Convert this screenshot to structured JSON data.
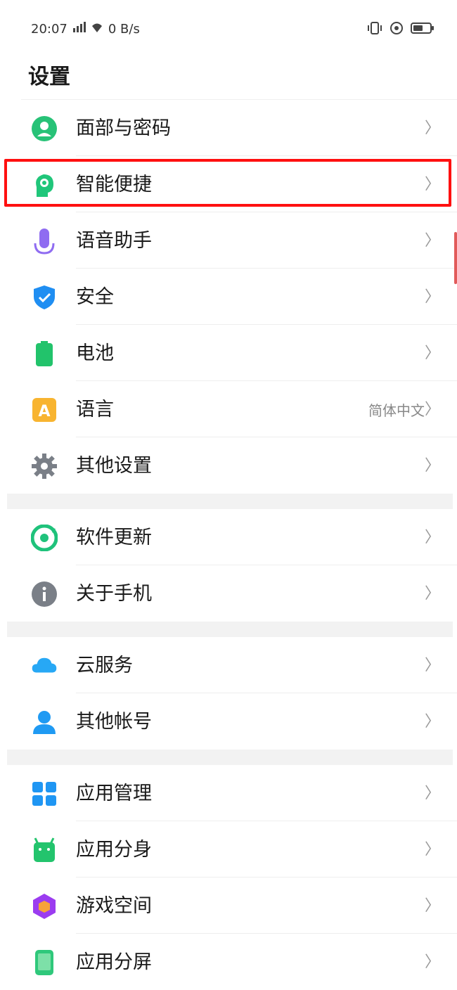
{
  "status_bar": {
    "time": "20:07",
    "speed": "0 B/s"
  },
  "title": "设置",
  "groups": [
    {
      "items": [
        {
          "label": "面部与密码",
          "icon": "face-password-icon",
          "color": "#27c277"
        },
        {
          "label": "智能便捷",
          "icon": "smart-assist-icon",
          "color": "#20c67a"
        },
        {
          "label": "语音助手",
          "icon": "microphone-icon",
          "color": "#8f6cf1"
        },
        {
          "label": "安全",
          "icon": "shield-icon",
          "color": "#1f8ef2"
        },
        {
          "label": "电池",
          "icon": "battery-icon",
          "color": "#22c36b"
        },
        {
          "label": "语言",
          "icon": "language-icon",
          "color": "#f8b430",
          "value": "简体中文"
        },
        {
          "label": "其他设置",
          "icon": "gear-icon",
          "color": "#7a7f87"
        }
      ]
    },
    {
      "items": [
        {
          "label": "软件更新",
          "icon": "software-update-icon",
          "color": "#1fc27b"
        },
        {
          "label": "关于手机",
          "icon": "info-icon",
          "color": "#7a7f87"
        }
      ]
    },
    {
      "items": [
        {
          "label": "云服务",
          "icon": "cloud-icon",
          "color": "#27a8f5"
        },
        {
          "label": "其他帐号",
          "icon": "account-icon",
          "color": "#1f9af3"
        }
      ]
    },
    {
      "items": [
        {
          "label": "应用管理",
          "icon": "app-manage-icon",
          "color": "#1f96f3"
        },
        {
          "label": "应用分身",
          "icon": "app-clone-icon",
          "color": "#23c46d"
        },
        {
          "label": "游戏空间",
          "icon": "game-space-icon",
          "color": "#9b3cf0"
        },
        {
          "label": "应用分屏",
          "icon": "split-screen-icon",
          "color": "#2fc87b"
        }
      ]
    }
  ],
  "chevron": "〉",
  "highlighted_item": "智能便捷"
}
